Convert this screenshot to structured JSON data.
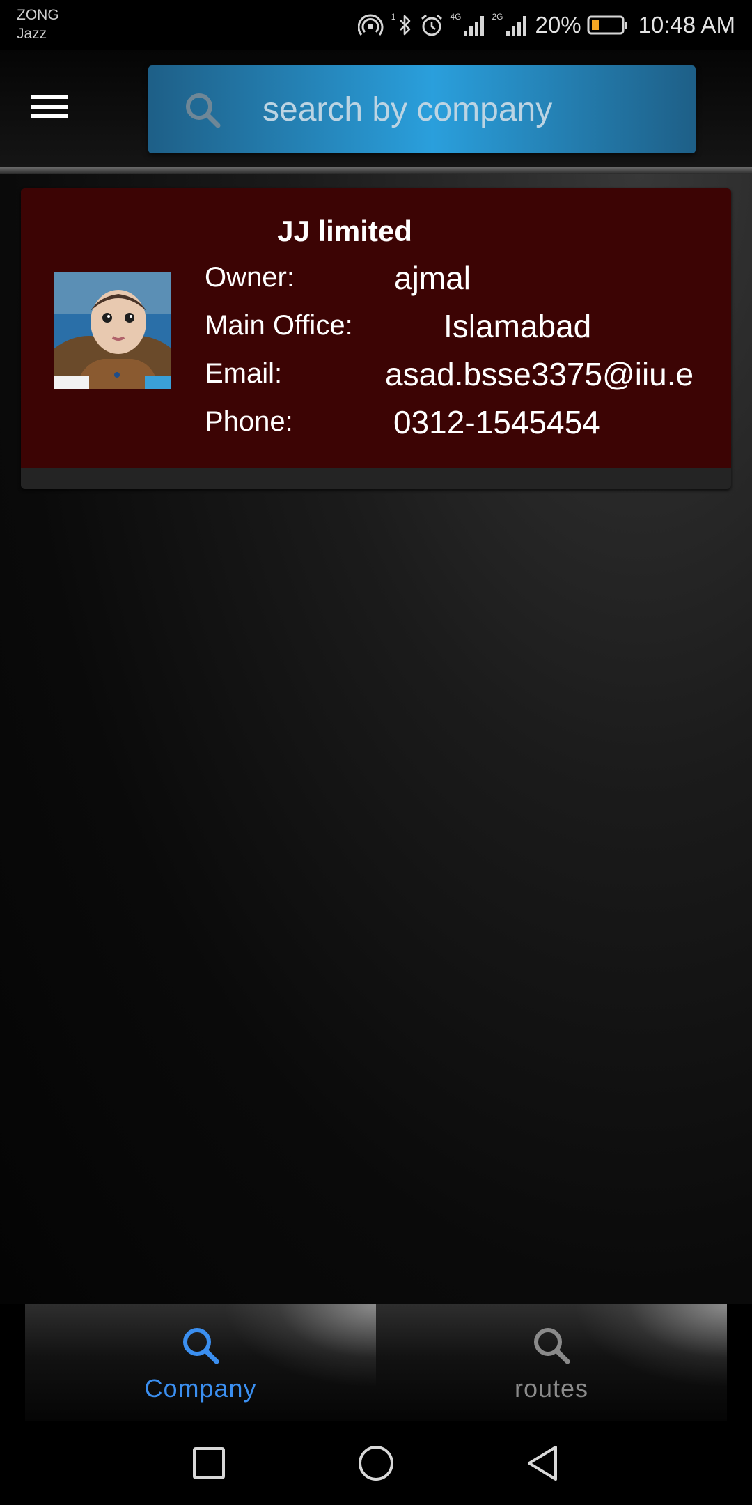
{
  "status_bar": {
    "carrier_1": "ZONG",
    "carrier_2": "Jazz",
    "sim_slot": "1",
    "network_1": "4G",
    "network_2": "2G",
    "battery": "20%",
    "time": "10:48 AM",
    "battery_color": "#f5a623"
  },
  "app_bar": {
    "menu_icon": "hamburger-menu-icon",
    "search": {
      "placeholder": "search by company",
      "value": "",
      "icon": "search-icon"
    }
  },
  "company_card": {
    "name": "JJ limited",
    "logo": "company-photo",
    "labels": {
      "owner": "Owner:",
      "main_office": "Main Office:",
      "email": "Email:",
      "phone": "Phone:"
    },
    "values": {
      "owner": "ajmal",
      "main_office": "Islamabad",
      "email": "asad.bsse3375@iiu.e",
      "phone": "0312-1545454"
    },
    "background_color": "#3c0404"
  },
  "bottom_tabs": [
    {
      "label": "Company",
      "icon": "search-icon",
      "active": true,
      "color": "#3b8ff0"
    },
    {
      "label": "routes",
      "icon": "search-icon",
      "active": false,
      "color": "#8a8a8a"
    }
  ],
  "system_nav": {
    "recent": "recent-apps-icon",
    "home": "home-icon",
    "back": "back-icon"
  }
}
